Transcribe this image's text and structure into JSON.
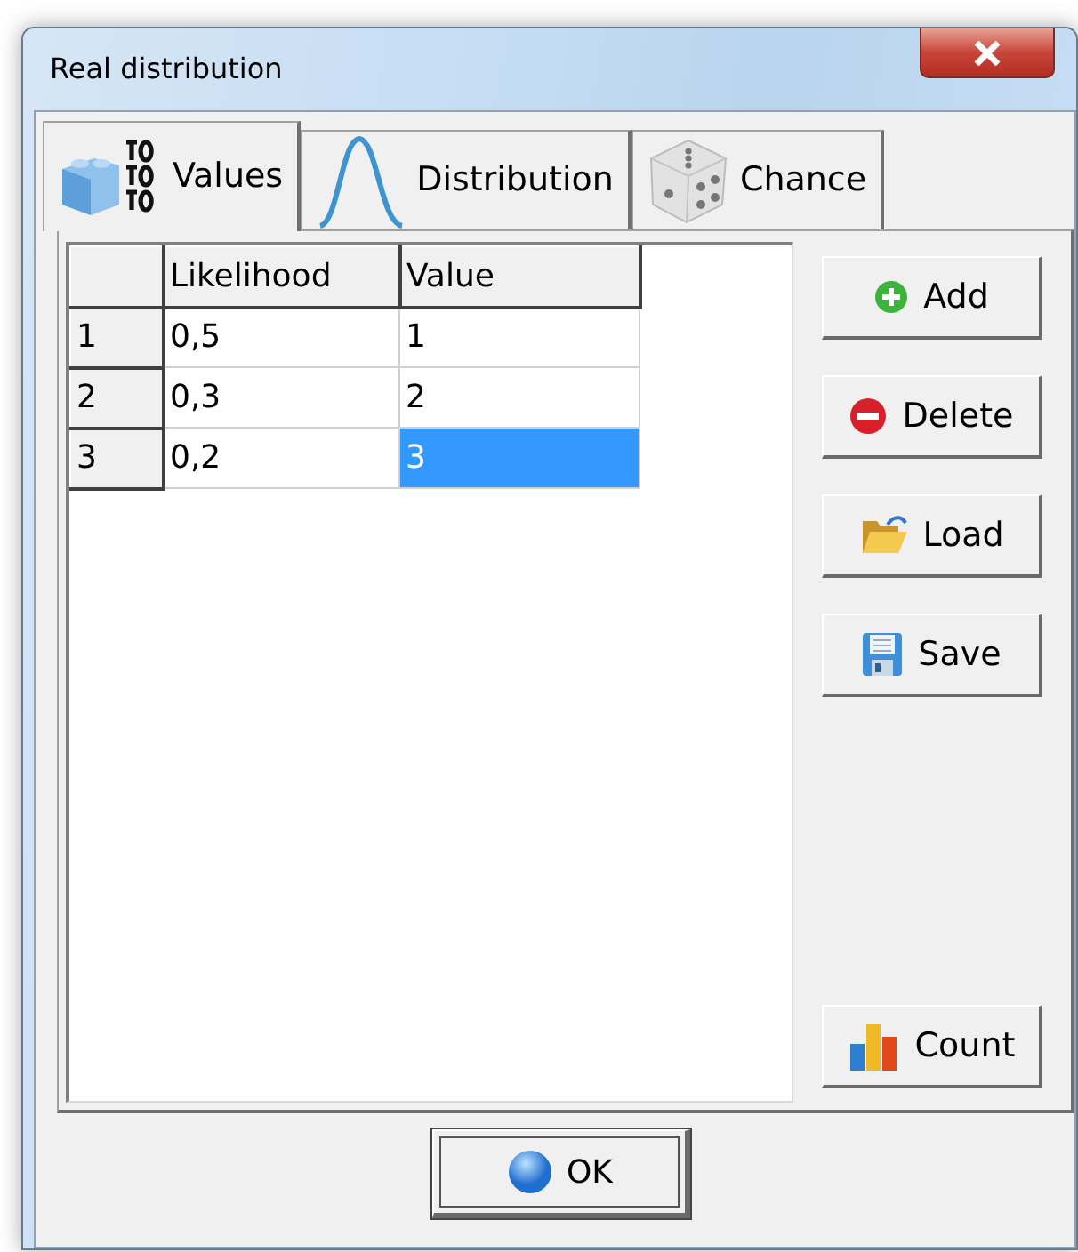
{
  "window": {
    "title": "Real distribution"
  },
  "tabs": [
    {
      "label": "Values",
      "kind": "values",
      "selected": true
    },
    {
      "label": "Distribution",
      "kind": "curve",
      "selected": false
    },
    {
      "label": "Chance",
      "kind": "dice",
      "selected": false
    }
  ],
  "table": {
    "columns": [
      "Likelihood",
      "Value"
    ],
    "rows": [
      {
        "number": "1",
        "cells": [
          {
            "text": "0,5",
            "selected": false
          },
          {
            "text": "1",
            "selected": false
          }
        ]
      },
      {
        "number": "2",
        "cells": [
          {
            "text": "0,3",
            "selected": false
          },
          {
            "text": "2",
            "selected": false
          }
        ]
      },
      {
        "number": "3",
        "cells": [
          {
            "text": "0,2",
            "selected": false
          },
          {
            "text": "3",
            "selected": true
          }
        ]
      }
    ]
  },
  "side_buttons": [
    {
      "label": "Add",
      "kind": "add"
    },
    {
      "label": "Delete",
      "kind": "delete"
    },
    {
      "label": "Load",
      "kind": "load"
    },
    {
      "label": "Save",
      "kind": "save"
    }
  ],
  "count_button": {
    "label": "Count",
    "kind": "count"
  },
  "ok_button": {
    "label": "OK",
    "focused": true
  }
}
